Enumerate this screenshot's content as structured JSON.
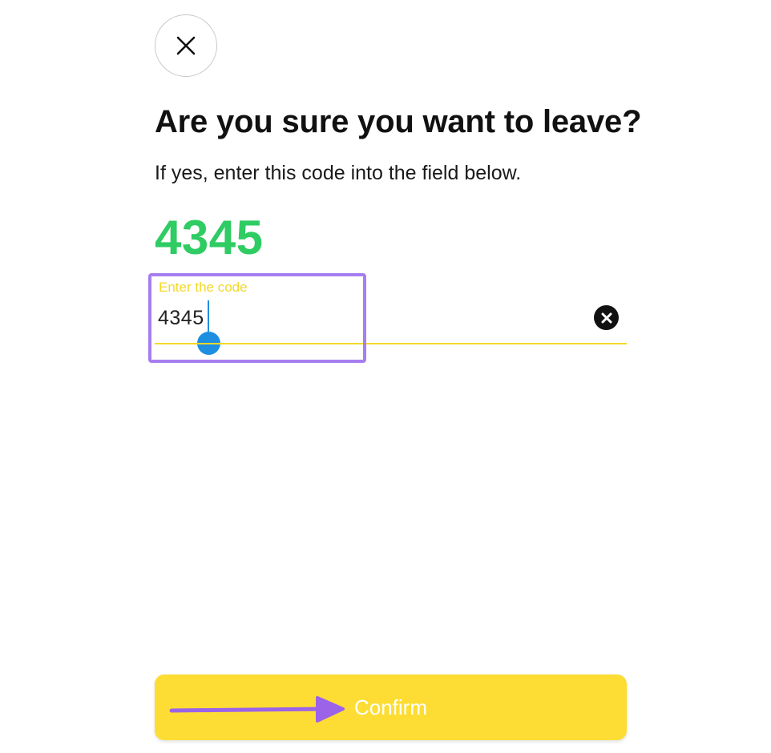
{
  "header": {
    "close_icon": "close-icon"
  },
  "dialog": {
    "title": "Are you sure you want to leave?",
    "subtitle": "If yes, enter this code into the field below.",
    "code": "4345"
  },
  "code_field": {
    "label": "Enter the code",
    "value": "4345",
    "clear_icon": "clear-circle-icon"
  },
  "footer": {
    "confirm_label": "Confirm"
  },
  "annotations": {
    "highlight_color": "#a77ef0",
    "arrow_color": "#9b63e8"
  },
  "colors": {
    "accent_yellow": "#fddd33",
    "code_green": "#2ecc63",
    "cursor_blue": "#1e8fe0",
    "label_yellow": "#f2d829"
  }
}
